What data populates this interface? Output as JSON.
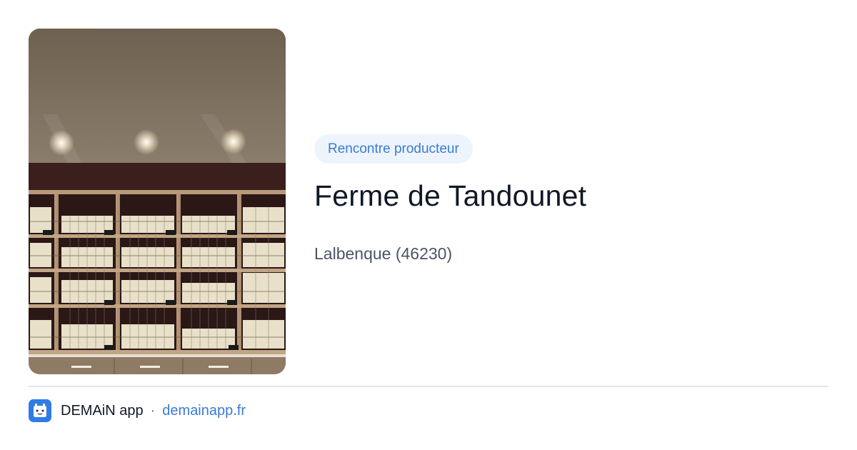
{
  "card": {
    "image_alt": "Shop shelves stocked with jars of foie gras and regional products",
    "badge": "Rencontre producteur",
    "title": "Ferme de Tandounet",
    "location": "Lalbenque (46230)"
  },
  "footer": {
    "app_name": "DEMAiN app",
    "separator": "·",
    "link": "demainapp.fr"
  },
  "colors": {
    "accent": "#3a7bd5",
    "badge_bg": "#eef4fc",
    "title": "#101827",
    "muted": "#4b5565",
    "logo": "#2f7ce6"
  },
  "icons": {
    "logo": "demain-app-logo-icon"
  }
}
